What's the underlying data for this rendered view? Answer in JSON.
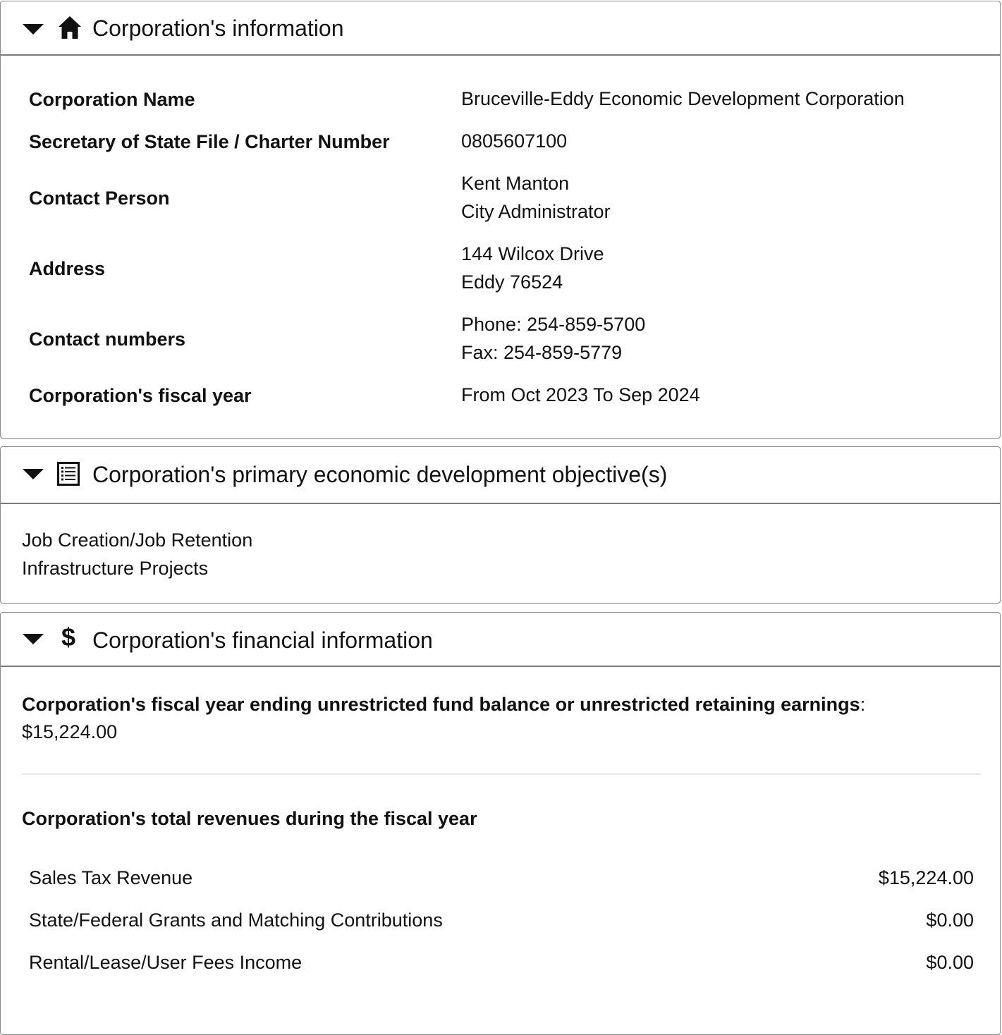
{
  "corp_info": {
    "title": "Corporation's information",
    "rows": [
      {
        "label": "Corporation Name",
        "lines": [
          "Bruceville-Eddy Economic Development Corporation"
        ]
      },
      {
        "label": "Secretary of State File / Charter Number",
        "lines": [
          "0805607100"
        ]
      },
      {
        "label": "Contact Person",
        "lines": [
          "Kent Manton",
          "City Administrator"
        ]
      },
      {
        "label": "Address",
        "lines": [
          "144 Wilcox Drive",
          "Eddy 76524"
        ]
      },
      {
        "label": "Contact numbers",
        "lines": [
          "Phone: 254-859-5700",
          "Fax: 254-859-5779"
        ]
      },
      {
        "label": "Corporation's fiscal year",
        "lines": [
          "From Oct 2023 To Sep 2024"
        ]
      }
    ]
  },
  "objectives": {
    "title": "Corporation's primary economic development objective(s)",
    "items": [
      "Job Creation/Job Retention",
      "Infrastructure Projects"
    ]
  },
  "financial": {
    "title": "Corporation's financial information",
    "fund_balance_label": "Corporation's fiscal year ending unrestricted fund balance or unrestricted retaining earnings",
    "fund_balance_sep": ":",
    "fund_balance_value": "$15,224.00",
    "revenues_heading": "Corporation's total revenues during the fiscal year",
    "revenues": [
      {
        "label": "Sales Tax Revenue",
        "value": "$15,224.00"
      },
      {
        "label": "State/Federal Grants and Matching Contributions",
        "value": "$0.00"
      },
      {
        "label": "Rental/Lease/User Fees Income",
        "value": "$0.00"
      }
    ]
  },
  "icons": {
    "caret": "caret-down-icon",
    "info": "home-icon",
    "objectives": "list-icon",
    "financial": "dollar-icon"
  }
}
